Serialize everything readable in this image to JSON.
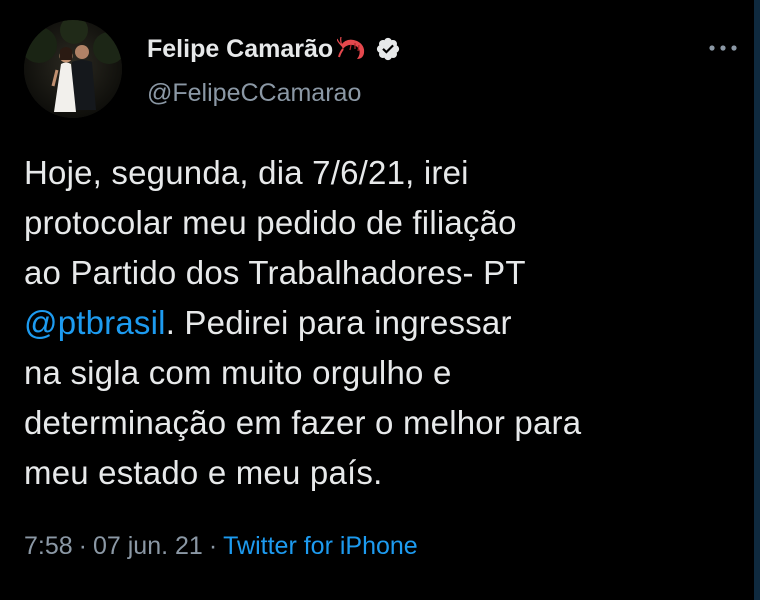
{
  "author": {
    "display_name": "Felipe Camarão",
    "handle": "@FelipeCCamarao",
    "verified": true,
    "name_emoji_icon": "shrimp-icon"
  },
  "tweet": {
    "lines": [
      [
        {
          "text": "Hoje, segunda, dia 7/6/21, irei"
        }
      ],
      [
        {
          "text": "protocolar meu pedido de filiação"
        }
      ],
      [
        {
          "text": "ao Partido dos Trabalhadores- PT"
        }
      ],
      [
        {
          "text": "@ptbrasil",
          "mention": true
        },
        {
          "text": ". Pedirei para ingressar"
        }
      ],
      [
        {
          "text": "na sigla com muito orgulho e"
        }
      ],
      [
        {
          "text": "determinação em fazer o melhor para"
        }
      ],
      [
        {
          "text": "meu estado e meu país."
        }
      ]
    ]
  },
  "meta": {
    "time": "7:58",
    "separator": "·",
    "date": "07 jun. 21",
    "source": "Twitter for iPhone"
  },
  "colors": {
    "background": "#000000",
    "text": "#e7e9ea",
    "secondary": "#8b98a5",
    "link": "#1d9bf0"
  },
  "icons": {
    "more": "more-options-icon",
    "verified": "verified-badge-icon"
  }
}
